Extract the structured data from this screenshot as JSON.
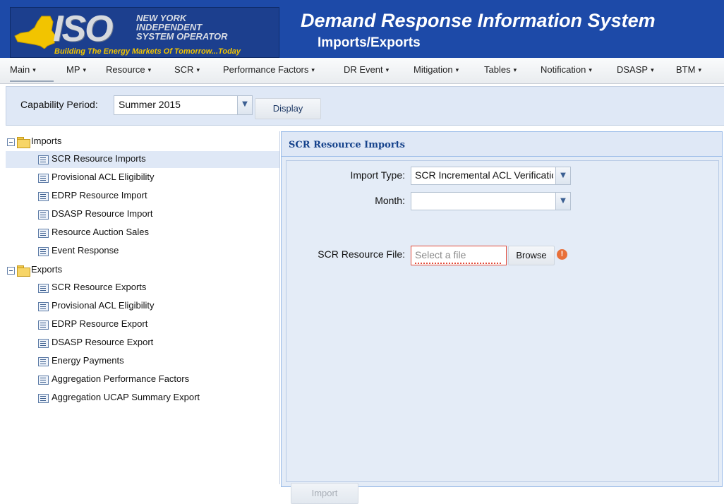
{
  "header": {
    "logo_text": "ISO",
    "logo_subtitle": "NEW YORK\nINDEPENDENT\nSYSTEM OPERATOR",
    "tagline": "Building The Energy Markets Of Tomorrow...Today",
    "app_title": "Demand Response Information System",
    "page_subtitle": "Imports/Exports",
    "colors": {
      "banner": "#1d4aa8",
      "tagline": "#f2c400"
    }
  },
  "menu": {
    "items": [
      {
        "label": "Main"
      },
      {
        "label": "MP"
      },
      {
        "label": "Resource"
      },
      {
        "label": "SCR"
      },
      {
        "label": "Performance Factors"
      },
      {
        "label": "DR Event"
      },
      {
        "label": "Mitigation"
      },
      {
        "label": "Tables"
      },
      {
        "label": "Notification"
      },
      {
        "label": "DSASP"
      },
      {
        "label": "BTM"
      }
    ],
    "caret": "▾"
  },
  "toolbar": {
    "capability_label": "Capability Period:",
    "capability_value": "Summer 2015",
    "display_label": "Display"
  },
  "tree": {
    "imports": {
      "label": "Imports",
      "items": [
        {
          "label": "SCR Resource Imports",
          "selected": true
        },
        {
          "label": "Provisional ACL Eligibility"
        },
        {
          "label": "EDRP Resource Import"
        },
        {
          "label": "DSASP Resource Import"
        },
        {
          "label": "Resource Auction Sales"
        },
        {
          "label": "Event Response"
        }
      ]
    },
    "exports": {
      "label": "Exports",
      "items": [
        {
          "label": "SCR Resource Exports"
        },
        {
          "label": "Provisional ACL Eligibility"
        },
        {
          "label": "EDRP Resource Export"
        },
        {
          "label": "DSASP Resource Export"
        },
        {
          "label": "Energy Payments"
        },
        {
          "label": "Aggregation Performance Factors"
        },
        {
          "label": "Aggregation UCAP Summary Export"
        }
      ]
    }
  },
  "panel": {
    "title": "SCR Resource Imports",
    "import_type_label": "Import Type:",
    "import_type_value": "SCR Incremental ACL Verificatio",
    "month_label": "Month:",
    "month_value": "",
    "file_label": "SCR Resource File:",
    "file_placeholder": "Select a file",
    "browse_label": "Browse",
    "error_glyph": "!",
    "import_label": "Import"
  }
}
